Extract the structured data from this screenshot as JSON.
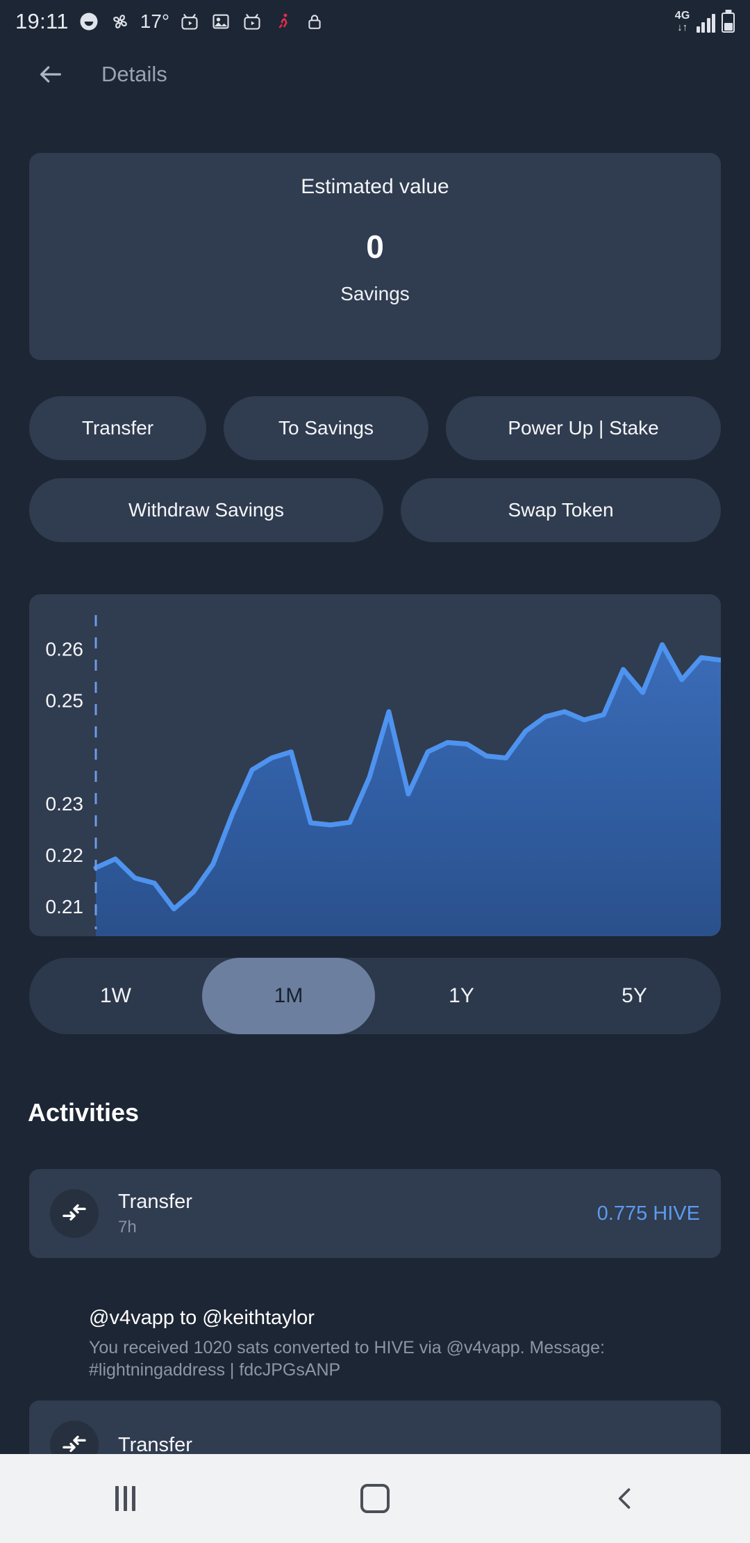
{
  "statusbar": {
    "time": "19:11",
    "temperature": "17°",
    "network": "4G",
    "icons": [
      "smiley-face-icon",
      "fan-icon",
      "tv-play-icon",
      "photo-icon",
      "tv-play-icon",
      "running-person-icon",
      "lock-icon"
    ],
    "data_arrows": "↓↑"
  },
  "header": {
    "title": "Details",
    "back_icon": "back-arrow-icon"
  },
  "estimated_card": {
    "label": "Estimated value",
    "value": "0",
    "subtitle": "Savings"
  },
  "actions": {
    "row1": [
      "Transfer",
      "To Savings",
      "Power Up | Stake"
    ],
    "row2": [
      "Withdraw Savings",
      "Swap Token"
    ]
  },
  "range_selector": {
    "options": [
      "1W",
      "1M",
      "1Y",
      "5Y"
    ],
    "selected": "1M"
  },
  "activities": {
    "title": "Activities",
    "items": [
      {
        "type": "Transfer",
        "time": "7h",
        "amount": "0.775 HIVE",
        "icon": "transfer-arrows-icon",
        "memo_head": "@v4vapp to @keithtaylor",
        "memo_body": "You received 1020 sats converted to HIVE via @v4vapp. Message: #lightningaddress | fdcJPGsANP"
      },
      {
        "type": "Transfer",
        "time": "",
        "amount": "",
        "icon": "transfer-arrows-icon",
        "memo_head": "",
        "memo_body": ""
      }
    ]
  },
  "navbar": {
    "recent_label": "recent-apps-icon",
    "home_label": "home-icon",
    "back_label": "back-icon"
  },
  "colors": {
    "background": "#1d2634",
    "card": "#303c4f",
    "accent": "#5b9bf0",
    "chart_line": "#4e93ef",
    "active_pill": "#6c7f9f"
  },
  "chart_data": {
    "type": "area",
    "title": "",
    "xlabel": "",
    "ylabel": "",
    "ytick_labels": [
      "0.26",
      "0.25",
      "0.23",
      "0.22",
      "0.21"
    ],
    "ytick_values": [
      0.26,
      0.25,
      0.23,
      0.22,
      0.21
    ],
    "ylim": [
      0.205,
      0.266
    ],
    "grid": false,
    "legend": "none",
    "series": [
      {
        "name": "price",
        "values": [
          0.2175,
          0.2192,
          0.2155,
          0.2145,
          0.2095,
          0.2128,
          0.2182,
          0.228,
          0.2365,
          0.2388,
          0.24,
          0.2262,
          0.2258,
          0.2263,
          0.235,
          0.2478,
          0.2318,
          0.24,
          0.2418,
          0.2415,
          0.2392,
          0.2388,
          0.244,
          0.2468,
          0.2478,
          0.2462,
          0.2472,
          0.256,
          0.2515,
          0.2608,
          0.254,
          0.2583,
          0.2578
        ]
      }
    ]
  }
}
